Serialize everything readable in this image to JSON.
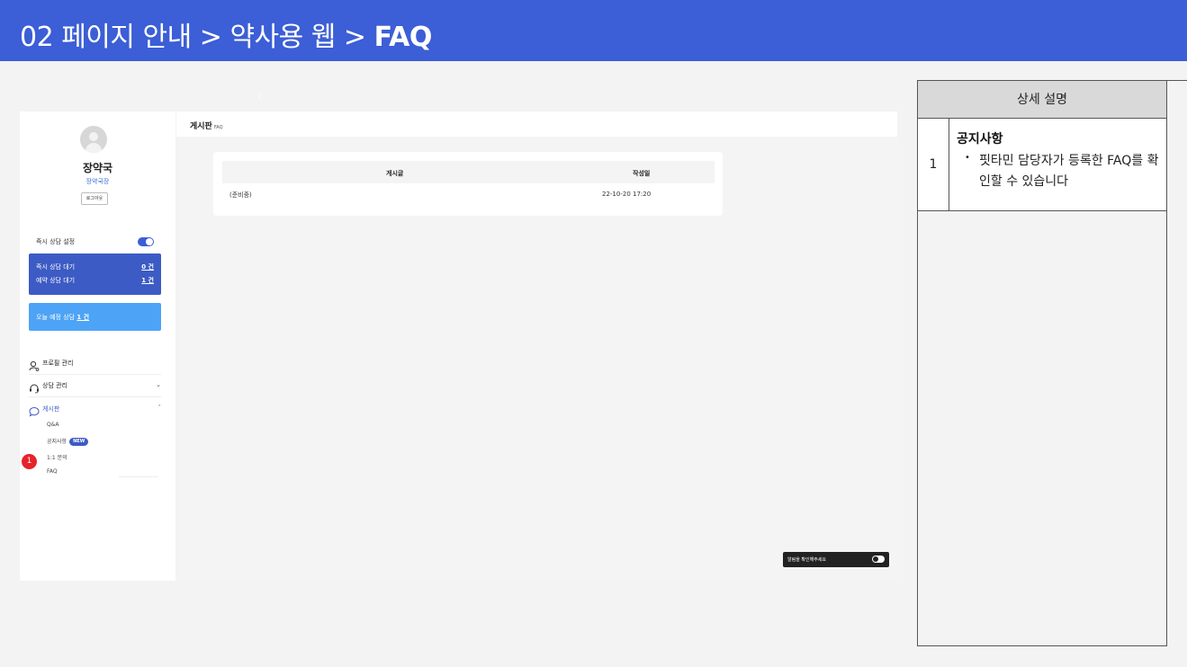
{
  "header": {
    "title_prefix": "02 페이지 안내 > 약사용 웹 > ",
    "title_bold": "FAQ"
  },
  "sidebar": {
    "user_name": "장약국",
    "user_role": "장약국장",
    "logout_label": "로그아웃",
    "instant_label": "즉시 상담 설정",
    "instant_on": true,
    "wait_instant_label": "즉시 상담 대기",
    "wait_instant_value": "0 건",
    "wait_reserve_label": "예약 상담 대기",
    "wait_reserve_value": "1 건",
    "today_label": "오늘 예정 상담",
    "today_value": "1 건",
    "menu": [
      {
        "label": "프로필 관리",
        "icon": "user-cog-icon"
      },
      {
        "label": "상담 관리",
        "icon": "headset-icon"
      },
      {
        "label": "게시판",
        "icon": "chat-bubble-icon"
      }
    ],
    "board_sub": [
      "Q&A",
      "공지사항",
      "1:1 문의",
      "FAQ"
    ],
    "new_badge": "NEW"
  },
  "marker": "1",
  "main": {
    "bar_title": "게시판",
    "bar_sub": "FAQ",
    "columns": [
      "게시글",
      "작성일"
    ],
    "rows": [
      {
        "post": "(준비중)",
        "date": "22-10-20 17:20"
      }
    ],
    "notice_label": "알림을 확인해주세요"
  },
  "desc": {
    "header": "상세 설명",
    "num": "1",
    "title": "공지사항",
    "bullet": "•",
    "text": "핏타민 담당자가 등록한 FAQ를 확인할 수 있습니다"
  },
  "colors": {
    "header_bg": "#3c5ed6",
    "accent": "#3c5bc4",
    "today_bg": "#4da3f5",
    "marker": "#e8222a"
  }
}
